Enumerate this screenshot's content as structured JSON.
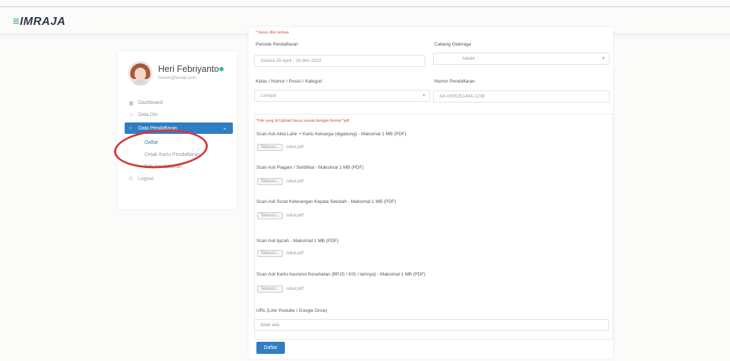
{
  "app": {
    "brand_mark": "≡",
    "brand_name": "IMRAJA"
  },
  "sidebar": {
    "user_name": "Heri Febriyanto",
    "user_email": "heriok@email.com",
    "menu": [
      {
        "label": "Dashboard",
        "icon": "dashboard-icon"
      },
      {
        "label": "Data Diri",
        "icon": "user-icon"
      },
      {
        "label": "Data Pendaftaran",
        "icon": "circle-icon"
      },
      {
        "label": "Daftar"
      },
      {
        "label": "Cetak Kartu Pendaftaran"
      },
      {
        "label": "Edit Pendaftaran"
      },
      {
        "label": "Logout",
        "icon": "power-icon"
      }
    ]
  },
  "form": {
    "required_note": "* harus diisi semua",
    "periode_label": "Periode Pendaftaran",
    "periode_value": "Selasa 26 April - 16 Mei 2023",
    "cabang_label": "Cabang Olahraga",
    "cabang_value": "Atletik",
    "kelas_label": "Kelas / Nomor / Posisi / Kategori",
    "kelas_value": "Lompat",
    "nomor_label": "Nomor Pendaftaran",
    "nomor_value": "AK-0005251404-1238",
    "file_note": "*File yang di Upload harus sesuai dengan format *pdf",
    "files": [
      {
        "label": "Scan Asli Akta Lahir + Kartu Keluarga (digabung) - Maksimal 1 MB (PDF)",
        "browse": "Telusuri...",
        "file": "suket.pdf"
      },
      {
        "label": "Scan Asli Piagam / Sertifikat - Maksimal 1 MB (PDF)",
        "browse": "Telusuri...",
        "file": "sukat.pdf"
      },
      {
        "label": "Scan Asli Surat Keterangan Kepala Sekolah - Maksimal 1 MB (PDF)",
        "browse": "Telusuri...",
        "file": "sukat.pdf"
      },
      {
        "label": "Scan Asli Ijazah - Maksimal 1 MB (PDF)",
        "browse": "Telusuri...",
        "file": "sukat.pdf"
      },
      {
        "label": "Scan Asli Kartu Asuransi Kesehatan (BPJS / KIS / lainnya) - Maksimal 1 MB (PDF)",
        "browse": "Telusuri...",
        "file": "sukat.pdf"
      }
    ],
    "url_label": "URL (Link Youtube / Google Drive)",
    "url_value": "tidak ada",
    "submit_label": "Daftar"
  },
  "colors": {
    "primary": "#2f7ec1",
    "required_red": "#d8463b",
    "online_green": "#3cb878",
    "annotation_red": "#d23a3a"
  }
}
